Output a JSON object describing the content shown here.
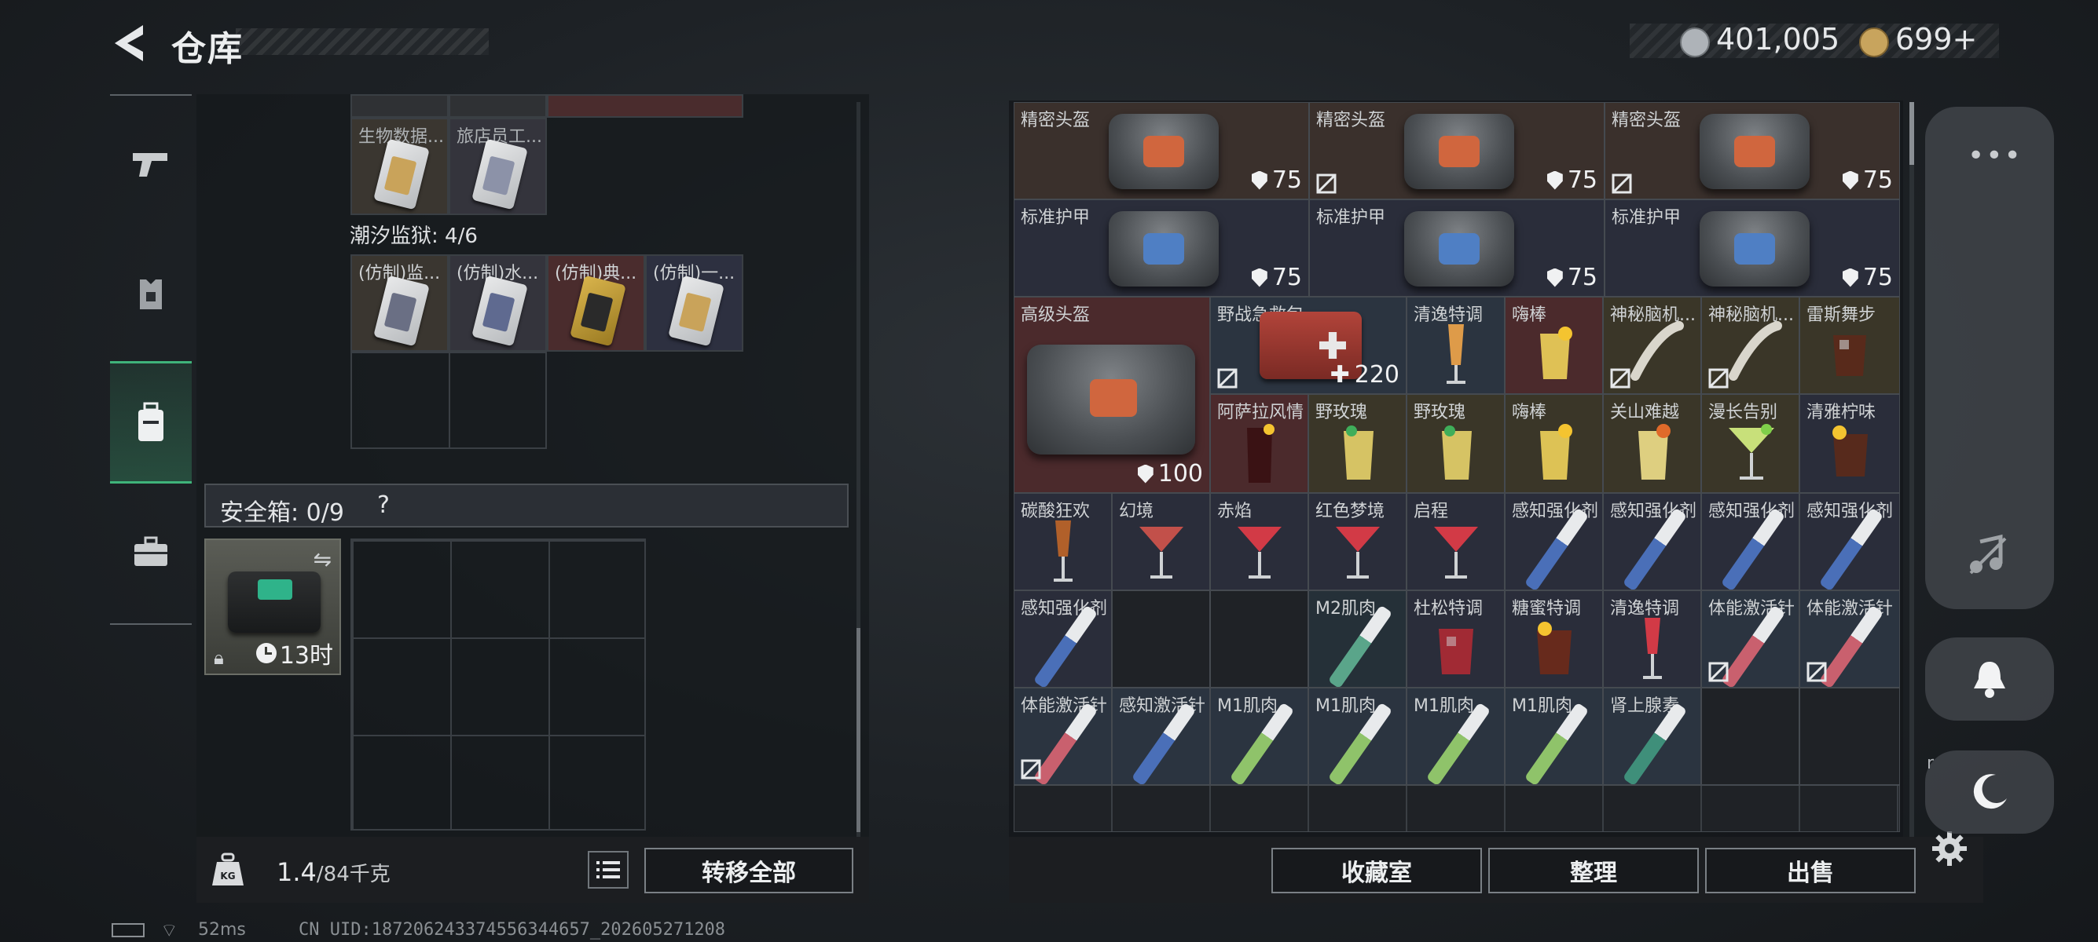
{
  "header": {
    "title": "仓库"
  },
  "currency": {
    "silver": "401,005",
    "gold": "699+"
  },
  "left": {
    "top_items": [
      {
        "name": "生物数据..."
      },
      {
        "name": "旅店员工..."
      }
    ],
    "prison_section": "潮汐监狱: 4/6",
    "prison_items": [
      {
        "name": "(仿制)监..."
      },
      {
        "name": "(仿制)水..."
      },
      {
        "name": "(仿制)典..."
      },
      {
        "name": "(仿制)一..."
      }
    ],
    "safe_label": "安全箱: 0/9",
    "safe_help": "?",
    "safe_timer": "13时",
    "weight_current": "1.4",
    "weight_max": "/84千克",
    "transfer_all": "转移全部"
  },
  "inventory": {
    "row1": [
      {
        "name": "精密头盔",
        "dur": "75"
      },
      {
        "name": "精密头盔",
        "dur": "75"
      },
      {
        "name": "精密头盔",
        "dur": "75"
      }
    ],
    "row2": [
      {
        "name": "标准护甲",
        "dur": "75"
      },
      {
        "name": "标准护甲",
        "dur": "75"
      },
      {
        "name": "标准护甲",
        "dur": "75"
      }
    ],
    "big_helmet": {
      "name": "高级头盔",
      "dur": "100"
    },
    "firstaid": {
      "name": "野战急救包",
      "count": "220"
    },
    "row3_small": [
      "清逸特调",
      "嗨棒",
      "神秘脑机...",
      "神秘脑机...",
      "雷斯舞步"
    ],
    "row4_small": [
      "阿萨拉风情",
      "野玫瑰",
      "野玫瑰",
      "嗨棒",
      "关山难越",
      "漫长告别",
      "清雅柠味"
    ],
    "row5": [
      "碳酸狂欢",
      "幻境",
      "赤焰",
      "红色梦境",
      "启程",
      "感知强化剂",
      "感知强化剂",
      "感知强化剂",
      "感知强化剂"
    ],
    "row6": [
      "感知强化剂",
      "",
      "",
      "M2肌肉...",
      "杜松特调",
      "糖蜜特调",
      "清逸特调",
      "体能激活针",
      "体能激活针"
    ],
    "row7": [
      "体能激活针",
      "感知激活针",
      "M1肌肉...",
      "M1肌肉...",
      "M1肌肉...",
      "M1肌肉...",
      "肾上腺素",
      "",
      ""
    ]
  },
  "buttons": {
    "collection": "收藏室",
    "organize": "整理",
    "sell": "出售"
  },
  "side": {
    "dots": "•••",
    "mark": "r"
  },
  "status": {
    "ping": "52ms",
    "uid": "CN UID:187206243374556344657_202605271208"
  },
  "colors": {
    "accent_green": "#3fb37a",
    "rarity_red": "#4b2a2c",
    "rarity_brown": "#3a302c",
    "rarity_blue": "#2a2d3a"
  }
}
